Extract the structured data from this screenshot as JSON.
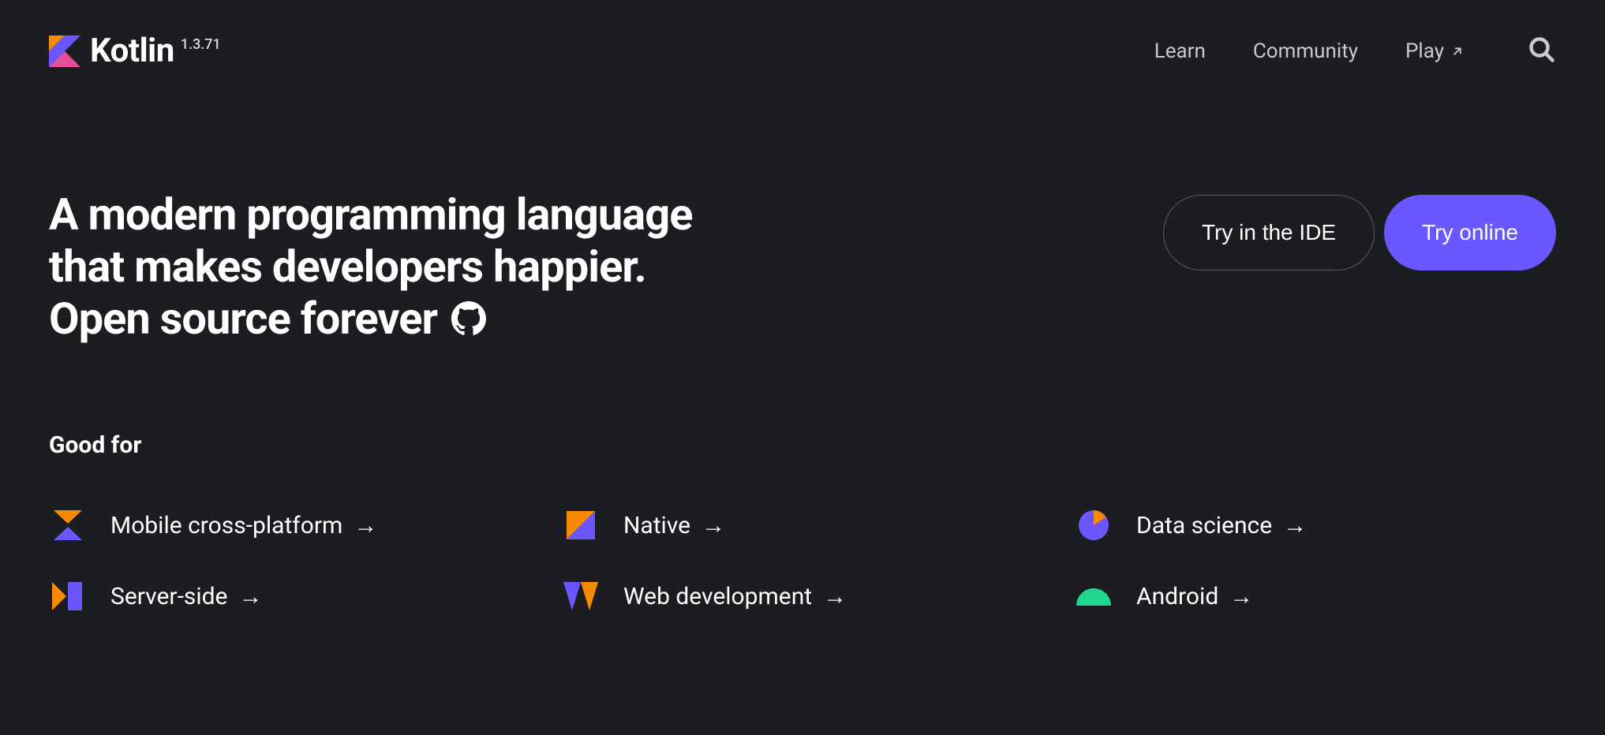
{
  "header": {
    "logo_text": "Kotlin",
    "version": "1.3.71",
    "nav": {
      "learn": "Learn",
      "community": "Community",
      "play": "Play"
    }
  },
  "hero": {
    "line1": "A modern programming language",
    "line2": "that makes developers happier.",
    "line3": "Open source forever"
  },
  "cta": {
    "ide": "Try in the IDE",
    "online": "Try online"
  },
  "good_for": {
    "title": "Good for",
    "items": [
      {
        "label": "Mobile cross-platform"
      },
      {
        "label": "Native"
      },
      {
        "label": "Data science"
      },
      {
        "label": "Server-side"
      },
      {
        "label": "Web development"
      },
      {
        "label": "Android"
      }
    ]
  }
}
